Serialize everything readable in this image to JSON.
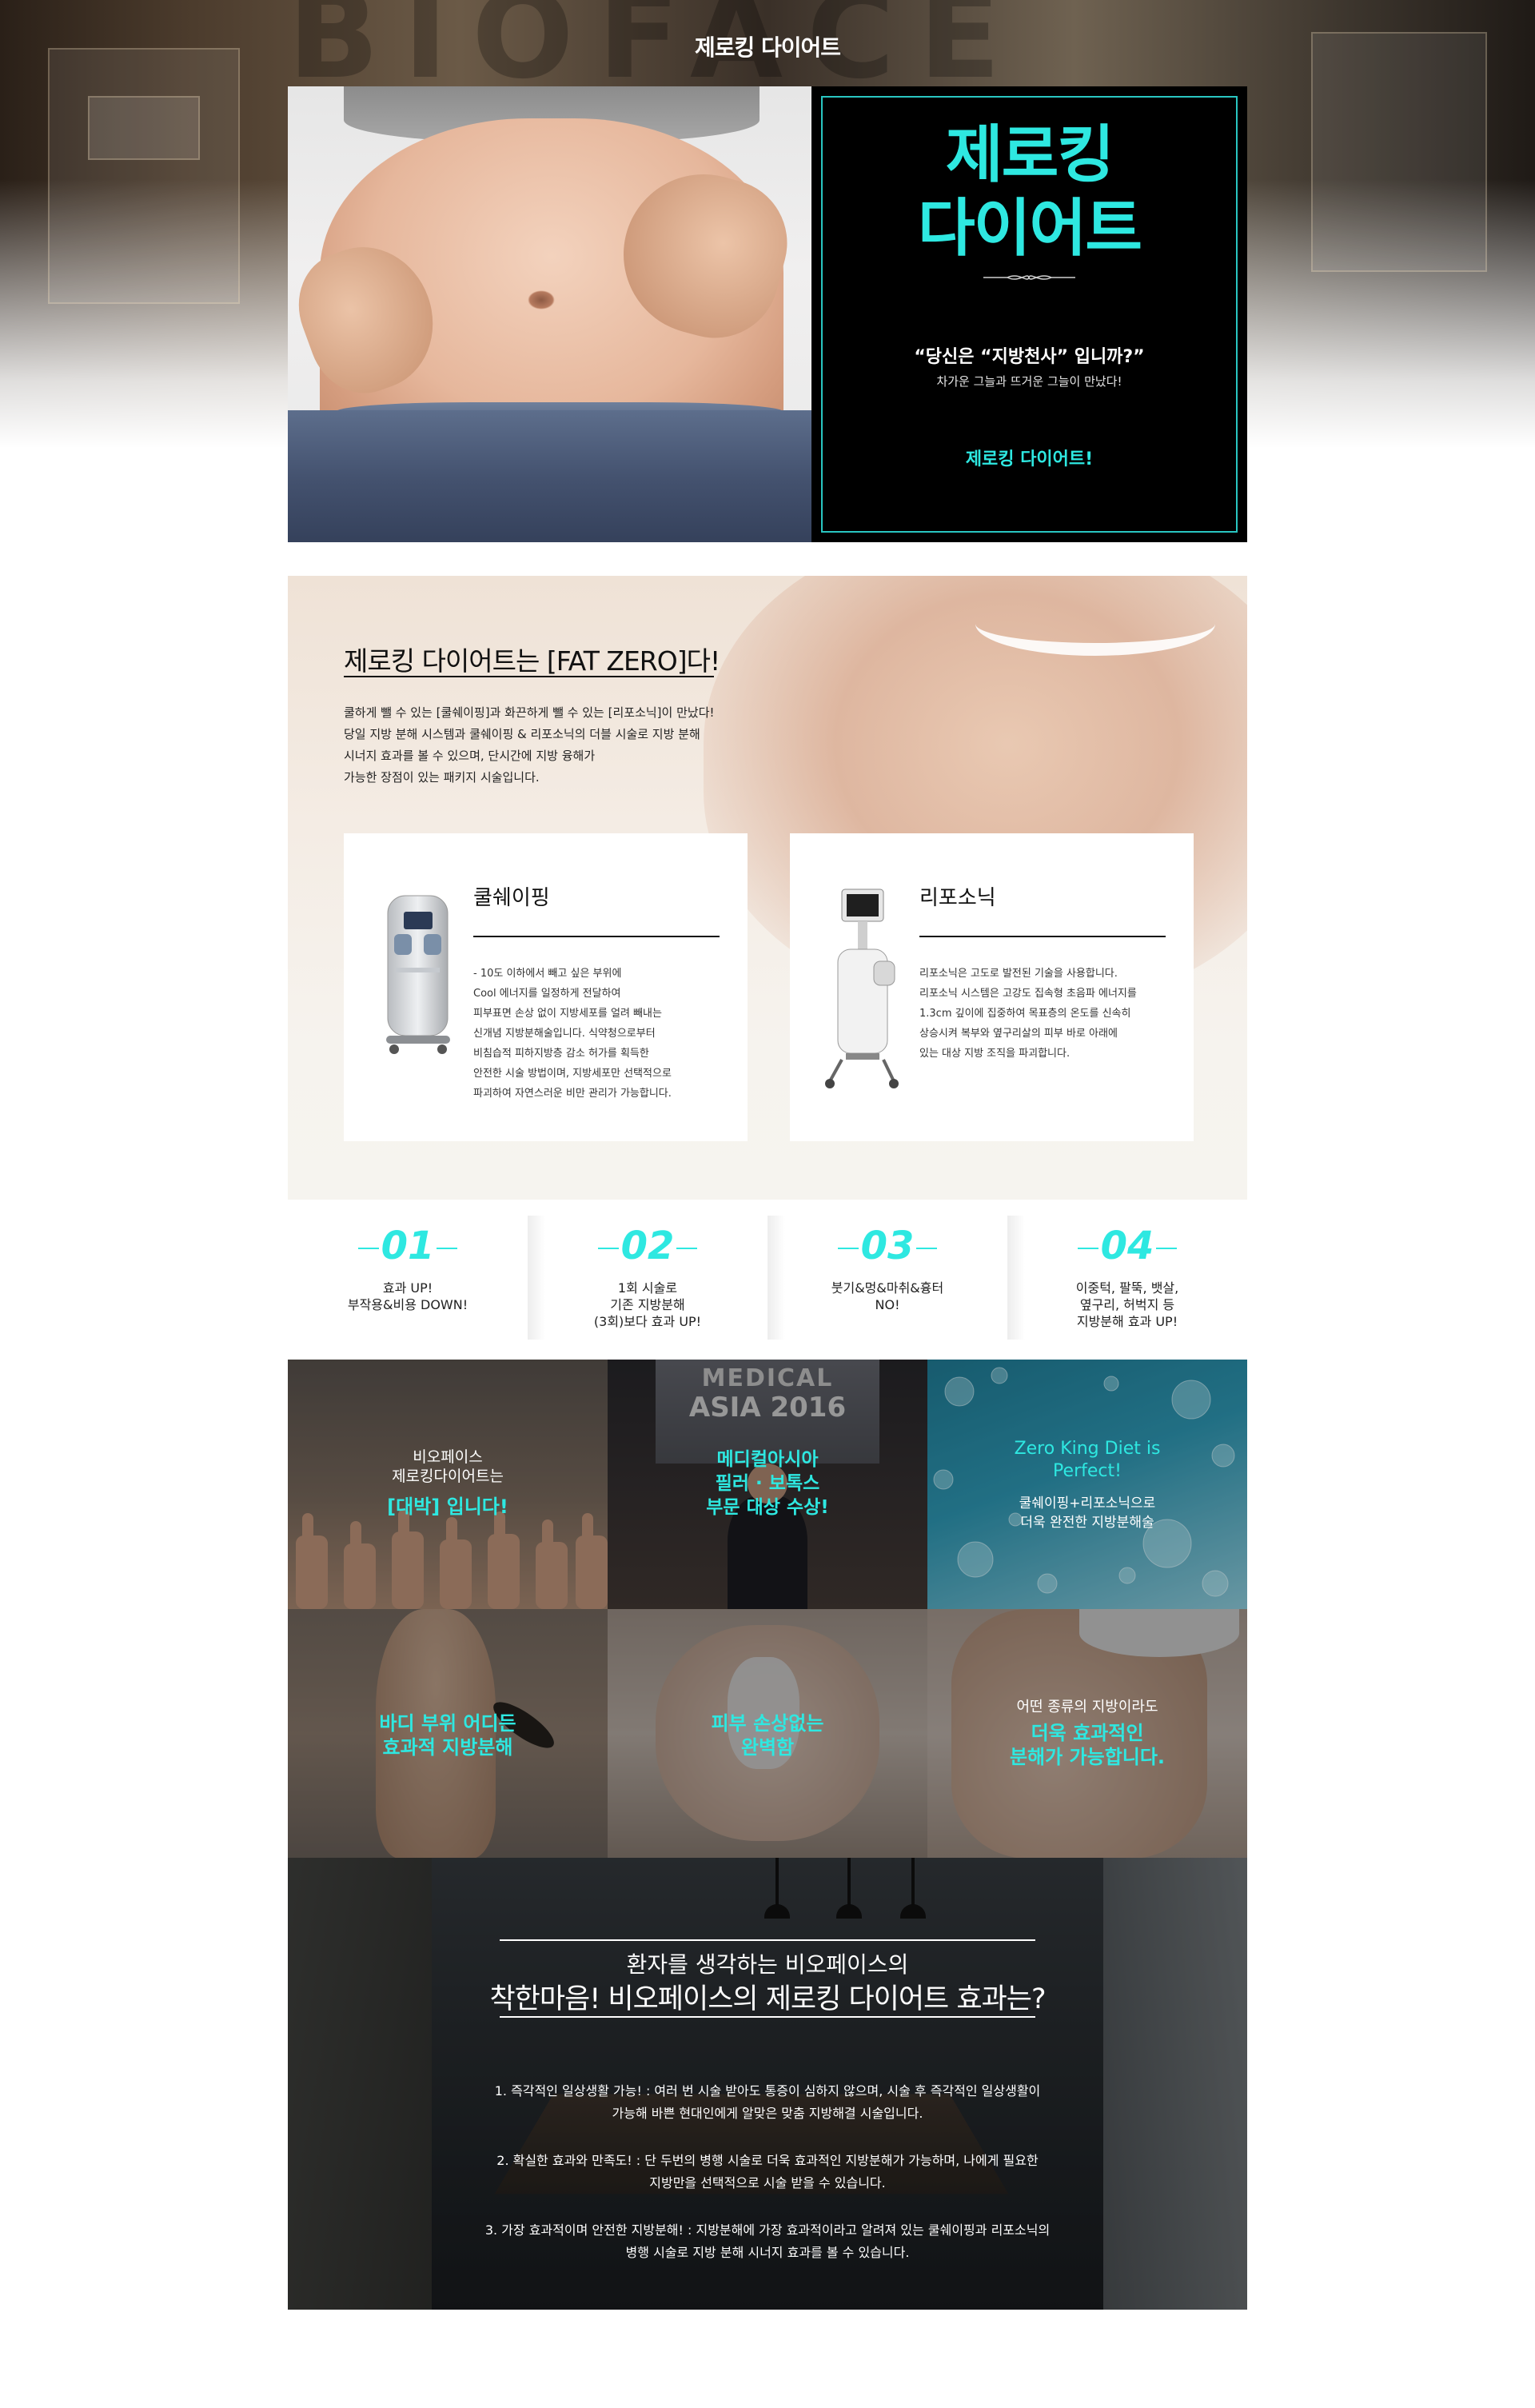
{
  "hero": {
    "heading": "제로킹 다이어트",
    "bg_text": "BIOFACE",
    "title_line1": "제로킹",
    "title_line2": "다이어트",
    "quote": "“당신은 “지방천사” 입니까?”",
    "sub": "차가운 그늘과 뜨거운 그늘이 만났다!",
    "cta": "제로킹 다이어트!"
  },
  "intro": {
    "title": "제로킹 다이어트는 [FAT ZERO]다!",
    "lines": [
      "쿨하게 뺄 수 있는 [쿨쉐이핑]과 화끈하게 뺄 수 있는 [리포소닉]이 만났다!",
      "당일 지방 분해 시스템과 쿨쉐이핑 & 리포소닉의 더블 시술로 지방 분해",
      "시너지 효과를 볼 수 있으며, 단시간에 지방 융해가",
      "가능한 장점이 있는 패키지 시술입니다."
    ]
  },
  "devices": [
    {
      "name": "쿨쉐이핑",
      "lines": [
        "- 10도 이하에서 빼고 싶은 부위에",
        "Cool 에너지를 일정하게 전달하여",
        "피부표면 손상 없이 지방세포를 얼려 빼내는",
        "신개념 지방분해술입니다. 식약청으로부터",
        "비침습적 피하지방층 감소 허가를 획득한",
        "안전한 시술 방법이며, 지방세포만 선택적으로",
        "파괴하여 자연스러운 비만 관리가 가능합니다."
      ]
    },
    {
      "name": "리포소닉",
      "lines": [
        "리포소닉은 고도로 발전된 기술을 사용합니다.",
        "리포소닉 시스템은 고강도 집속형 초음파 에너지를",
        "1.3cm 깊이에 집중하여 목표층의 온도를 신속히",
        "상승시켜 복부와 옆구리살의 피부 바로 아래에",
        "있는 대상 지방 조직을 파괴합니다."
      ]
    }
  ],
  "benefits": [
    {
      "num": "01",
      "lines": [
        "효과 UP!",
        "부작용&비용 DOWN!"
      ]
    },
    {
      "num": "02",
      "lines": [
        "1회 시술로",
        "기존 지방분해",
        "(3회)보다 효과 UP!"
      ]
    },
    {
      "num": "03",
      "lines": [
        "붓기&멍&마취&흉터",
        "NO!"
      ]
    },
    {
      "num": "04",
      "lines": [
        "이중턱, 팔뚝, 뱃살,",
        "옆구리, 허벅지 등",
        "지방분해 효과 UP!"
      ]
    }
  ],
  "tiles": {
    "t1": {
      "line1": "비오페이스",
      "line2": "제로킹다이어트는",
      "highlight": "[대박] 입니다!"
    },
    "t2": {
      "poster_top": "MEDICAL",
      "poster_mid": "ASIA 2016",
      "line1": "메디컬아시아",
      "line2": "필러 · 보톡스",
      "line3": "부문 대상 수상!"
    },
    "t3": {
      "line1": "Zero King Diet  is",
      "line2": "Perfect!",
      "line3": "쿨쉐이핑+리포소닉으로",
      "line4": "더욱 완전한 지방분해술"
    },
    "t4": {
      "line1": "바디 부위 어디든",
      "line2": "효과적 지방분해"
    },
    "t5": {
      "line1": "피부 손상없는",
      "line2": "완벽함"
    },
    "t6": {
      "line1": "어떤 종류의 지방이라도",
      "line2": "더욱 효과적인",
      "line3": "분해가 가능합니다."
    }
  },
  "philosophy": {
    "sub": "환자를 생각하는 비오페이스의",
    "title": "착한마음! 비오페이스의 제로킹 다이어트 효과는?",
    "points": [
      [
        "1. 즉각적인 일상생활 가능! : 여러 번 시술 받아도 통증이 심하지 않으며, 시술 후 즉각적인 일상생활이",
        "가능해 바쁜 현대인에게 알맞은 맞춤 지방해결 시술입니다."
      ],
      [
        "2. 확실한 효과와 만족도! : 단 두번의 병행 시술로 더욱 효과적인 지방분해가 가능하며, 나에게 필요한",
        "지방만을 선택적으로 시술 받을 수 있습니다."
      ],
      [
        "3. 가장 효과적이며 안전한 지방분해! : 지방분해에 가장 효과적이라고 알려져 있는 쿨쉐이핑과 리포소닉의",
        "병행 시술로 지방 분해 시너지 효과를 볼 수 있습니다."
      ]
    ]
  },
  "colors": {
    "accent": "#2ee8e1",
    "frame": "#29c6c1",
    "dark": "#000000"
  }
}
